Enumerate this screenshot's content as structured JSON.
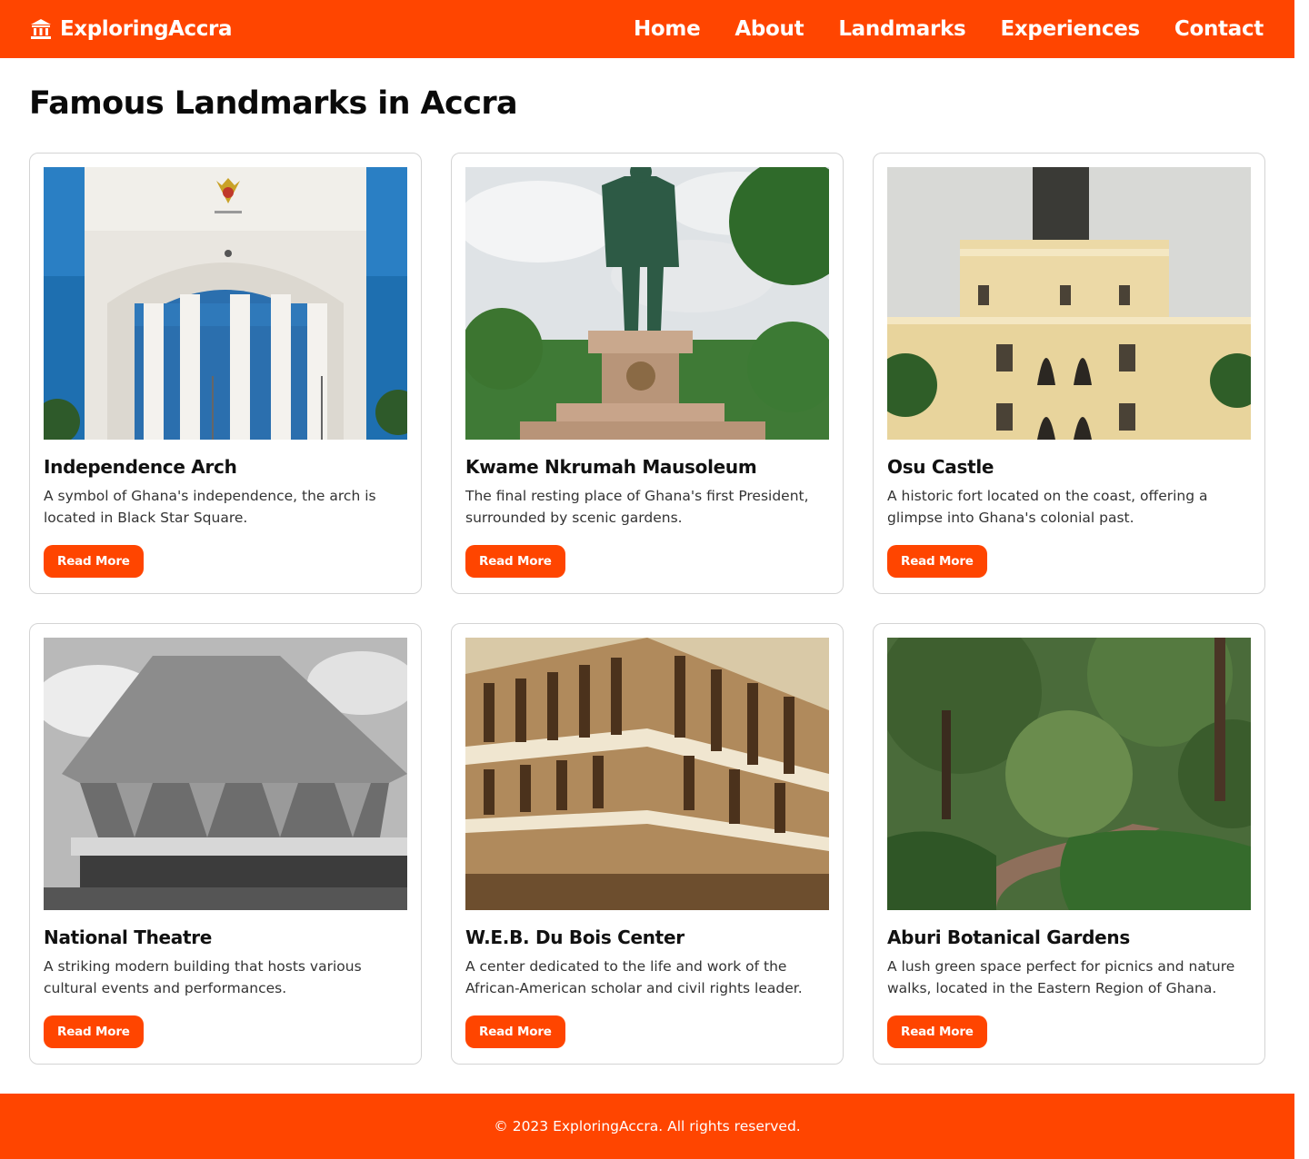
{
  "header": {
    "brand_icon": "landmark-icon",
    "brand_name": "ExploringAccra",
    "nav": [
      {
        "label": "Home"
      },
      {
        "label": "About"
      },
      {
        "label": "Landmarks"
      },
      {
        "label": "Experiences"
      },
      {
        "label": "Contact"
      }
    ]
  },
  "main": {
    "title": "Famous Landmarks in Accra",
    "cards": [
      {
        "title": "Independence Arch",
        "description": "A symbol of Ghana's independence, the arch is located in Black Star Square.",
        "button": "Read More",
        "image": "independence-arch-photo"
      },
      {
        "title": "Kwame Nkrumah Mausoleum",
        "description": "The final resting place of Ghana's first President, surrounded by scenic gardens.",
        "button": "Read More",
        "image": "nkrumah-statue-photo"
      },
      {
        "title": "Osu Castle",
        "description": "A historic fort located on the coast, offering a glimpse into Ghana's colonial past.",
        "button": "Read More",
        "image": "osu-castle-photo"
      },
      {
        "title": "National Theatre",
        "description": "A striking modern building that hosts various cultural events and performances.",
        "button": "Read More",
        "image": "national-theatre-photo"
      },
      {
        "title": "W.E.B. Du Bois Center",
        "description": "A center dedicated to the life and work of the African-American scholar and civil rights leader.",
        "button": "Read More",
        "image": "du-bois-center-photo"
      },
      {
        "title": "Aburi Botanical Gardens",
        "description": "A lush green space perfect for picnics and nature walks, located in the Eastern Region of Ghana.",
        "button": "Read More",
        "image": "aburi-gardens-photo"
      }
    ]
  },
  "footer": {
    "text": "© 2023 ExploringAccra. All rights reserved."
  },
  "colors": {
    "accent": "#ff4500",
    "background": "#ffffff",
    "text": "#111111",
    "card_border": "#d4d4d4"
  }
}
